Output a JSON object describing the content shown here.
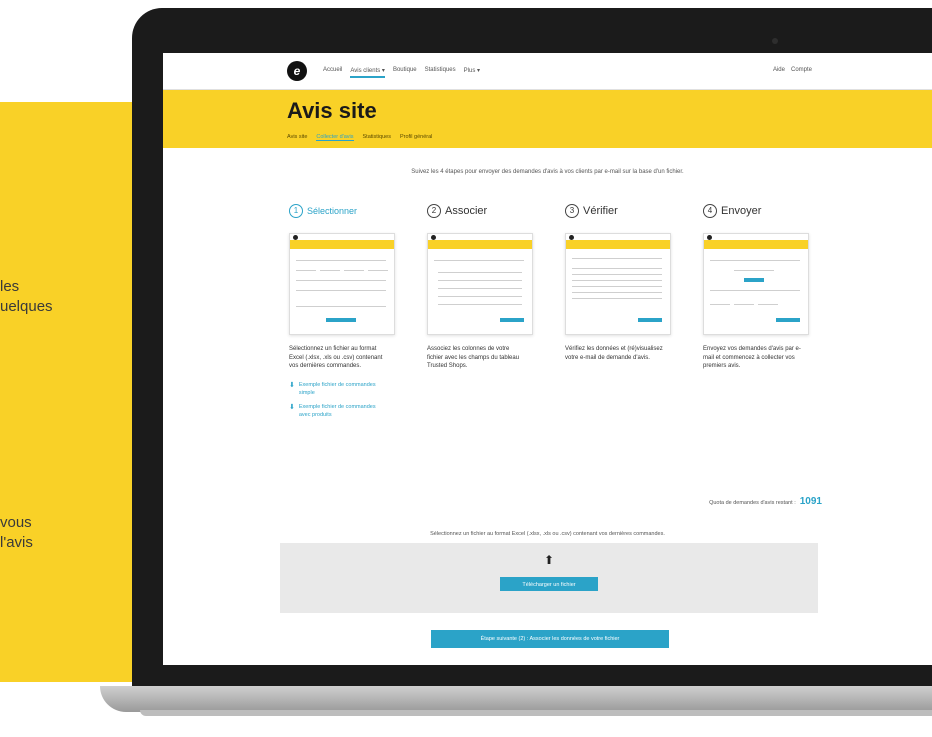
{
  "marketing": {
    "lines": [
      "les",
      "uelques",
      "vous",
      "l'avis"
    ],
    "panel_color": "#f9d127"
  },
  "app": {
    "logo_letter": "e",
    "nav": [
      "Accueil",
      "Avis clients ▾",
      "Boutique",
      "Statistiques",
      "Plus ▾"
    ],
    "nav_right": [
      "Aide",
      "Compte"
    ],
    "page_title": "Avis site",
    "subtabs": [
      "Avis site",
      "Collecter d'avis",
      "Statistiques",
      "Profil général"
    ],
    "intro": "Suivez les 4 étapes pour envoyer des demandes d'avis à vos clients par e-mail sur la base d'un fichier.",
    "steps": [
      {
        "num": "1",
        "label": "Sélectionner",
        "desc": "Sélectionnez un fichier au format Excel (.xlsx, .xls ou .csv) contenant vos dernières commandes."
      },
      {
        "num": "2",
        "label": "Associer",
        "desc": "Associez les colonnes de votre fichier avec les champs du tableau Trusted Shops."
      },
      {
        "num": "3",
        "label": "Vérifier",
        "desc": "Vérifiez les données et (ré)visualisez votre e-mail de demande d'avis."
      },
      {
        "num": "4",
        "label": "Envoyer",
        "desc": "Envoyez vos demandes d'avis par e-mail et commencez à collecter vos premiers avis."
      }
    ],
    "downloads": [
      "Exemple fichier de commandes simple",
      "Exemple fichier de commandes avec produits"
    ],
    "quota_label": "Quota de demandes d'avis restant :",
    "quota_value": "1091",
    "upload_hint": "Sélectionnez un fichier au format Excel (.xlsx, .xls ou .csv) contenant vos dernières commandes.",
    "upload_button": "Télécharger un fichier",
    "next_button": "Étape suivante (2) : Associer les données de votre fichier",
    "accent": "#2ba3c8",
    "brand_yellow": "#f9d127"
  }
}
